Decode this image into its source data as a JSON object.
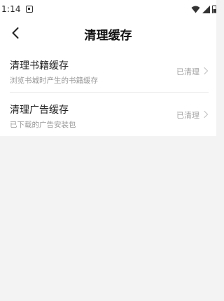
{
  "status_bar": {
    "time": "1:14",
    "icons": [
      "notification-icon",
      "wifi-icon",
      "signal-icon",
      "battery-icon"
    ]
  },
  "header": {
    "back_icon": "back-arrow-icon",
    "title": "清理缓存"
  },
  "items": [
    {
      "title": "清理书籍缓存",
      "description": "浏览书城时产生的书籍缓存",
      "status": "已清理",
      "icon": "chevron-right-icon"
    },
    {
      "title": "清理广告缓存",
      "description": "已下载的广告安装包",
      "status": "已清理",
      "icon": "chevron-right-icon"
    }
  ],
  "colors": {
    "page_background": "#f3f3f3",
    "card_background": "#ffffff",
    "primary_text": "#222222",
    "secondary_text": "#999999",
    "status_text": "#a3a3a3"
  }
}
